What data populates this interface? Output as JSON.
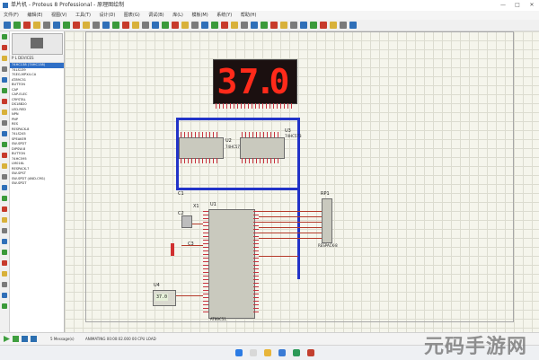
{
  "window": {
    "title": "单片机 - Proteus 8 Professional - 原理图绘制",
    "controls": [
      "—",
      "□",
      "✕"
    ]
  },
  "menu": [
    "文件(F)",
    "编辑(E)",
    "视图(V)",
    "工具(T)",
    "设计(D)",
    "图表(G)",
    "调试(B)",
    "库(L)",
    "模板(M)",
    "系统(Y)",
    "帮助(H)"
  ],
  "toolbar": {
    "buttons": [
      "new-file",
      "open-folder",
      "save",
      "import",
      "export",
      "print",
      "area",
      "home",
      "grid",
      "origin",
      "pan",
      "zoom-in",
      "zoom-out",
      "zoom-all",
      "zoom-area",
      "undo",
      "redo",
      "cut",
      "copy",
      "paste",
      "block-copy",
      "block-move",
      "block-rotate",
      "block-delete",
      "pick",
      "make-device",
      "packaging",
      "decompose",
      "wire-autorouter",
      "search",
      "property-assign",
      "netlist",
      "bill-of-materials",
      "design-rule",
      "pcb",
      "3d"
    ],
    "colors": {
      "blue": "#2f6fb8",
      "green": "#3a9a3a",
      "red": "#c73a2b",
      "yellow": "#d8b13a"
    }
  },
  "panel": {
    "header_left": "P  L  DEVICES",
    "header_right": "",
    "parts": [
      "74HC138 (74HC138)",
      "74LS139",
      "7SEG-MPX4-CA",
      "AT89C51",
      "BUTTON",
      "CAP",
      "CAP-ELEC",
      "CRYSTAL",
      "DS18B20",
      "LED-RED",
      "NPN",
      "PNP",
      "RES",
      "RESPACK-8",
      "74LS245",
      "SPEAKER",
      "SW-SPDT",
      "DIPSW-8",
      "BUTTON",
      "74HC595",
      "LM016L",
      "RESPACK-7",
      "SW-SPST",
      "SW-SPDT (AND-CM1)",
      "SW-SPDT"
    ],
    "selected_index": 0
  },
  "canvas": {
    "display": {
      "digits": [
        "3",
        "7",
        ".",
        "0"
      ]
    },
    "chips": {
      "u2_ref": "U2",
      "u2_type": "74HC573",
      "u3_ref": "U3",
      "u3_type": "74HC573",
      "u1_ref": "U1",
      "u1_type": "AT89C51",
      "rp1_ref": "RP1",
      "rp1_type": "RESPACK-8",
      "c1": "C1",
      "c2": "C2",
      "c3": "C3",
      "x1": "X1",
      "u4": "U4"
    },
    "sensor_value": "37.0"
  },
  "status": {
    "text": "5 Message(s)",
    "coordinate": "ANIMATING 00:00:02.000 00 CPU LOAD",
    "zoom": ""
  },
  "watermark": "元码手游网"
}
